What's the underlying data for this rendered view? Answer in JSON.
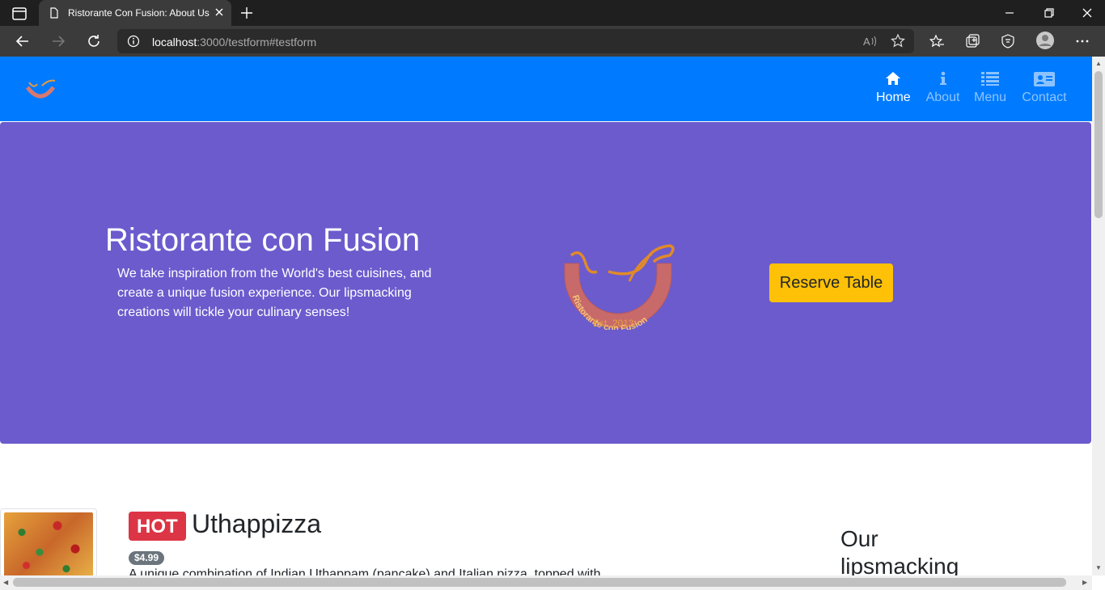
{
  "browser": {
    "tab_title": "Ristorante Con Fusion: About Us",
    "url_host": "localhost",
    "url_rest": ":3000/testform#testform"
  },
  "navbar": {
    "items": [
      {
        "label": "Home",
        "icon": "home-icon"
      },
      {
        "label": "About",
        "icon": "info-icon"
      },
      {
        "label": "Menu",
        "icon": "list-icon"
      },
      {
        "label": "Contact",
        "icon": "address-card-icon"
      }
    ],
    "active": "Home"
  },
  "jumbotron": {
    "title": "Ristorante con Fusion",
    "text": "We take inspiration from the World's best cuisines, and create a unique fusion experience. Our lipsmacking creations will tickle your culinary senses!",
    "logo_text": "Ristorante con Fusion",
    "logo_est": "Est. 2013",
    "reserve_label": "Reserve Table"
  },
  "featured": {
    "badge": "HOT",
    "name": "Uthappizza",
    "price": "$4.99",
    "description": "A unique combination of Indian Uthappam (pancake) and Italian pizza, topped with"
  },
  "side": {
    "heading": "Our lipsmacking"
  },
  "colors": {
    "navbar": "#007bff",
    "jumbotron": "#6b5bcd",
    "reserve": "#ffc107",
    "hot": "#dc3545"
  }
}
